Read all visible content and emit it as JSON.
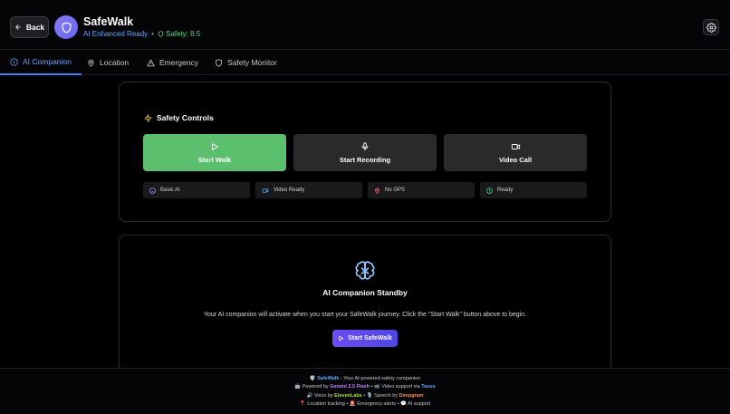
{
  "header": {
    "back_label": "Back",
    "title": "SafeWalk",
    "status_ai": "AI Enhanced Ready",
    "status_sep": "•",
    "safety_label": "Safety: 8.5"
  },
  "tabs": [
    {
      "label": "AI Companion",
      "icon": "info-icon",
      "active": true
    },
    {
      "label": "Location",
      "icon": "map-pin-icon",
      "active": false
    },
    {
      "label": "Emergency",
      "icon": "warning-icon",
      "active": false
    },
    {
      "label": "Safety Monitor",
      "icon": "shield-icon",
      "active": false
    }
  ],
  "controls": {
    "title": "Safety Controls",
    "buttons": [
      {
        "label": "Start Walk",
        "icon": "play-icon"
      },
      {
        "label": "Start Recording",
        "icon": "microphone-icon"
      },
      {
        "label": "Video Call",
        "icon": "video-icon"
      }
    ],
    "chips": [
      {
        "label": "Basic AI",
        "icon": "bot-icon"
      },
      {
        "label": "Video Ready",
        "icon": "video-icon"
      },
      {
        "label": "No GPS",
        "icon": "map-pin-icon"
      },
      {
        "label": "Ready",
        "icon": "clock-icon"
      }
    ]
  },
  "standby": {
    "title": "AI Companion Standby",
    "description": "Your AI companion will activate when you start your SafeWalk journey. Click the \"Start Walk\" button above to begin.",
    "button_label": "Start SafeWalk"
  },
  "footer": {
    "line1": {
      "icon": "🛡️",
      "brand": "SafeWalk",
      "text": " - Your AI-powered safety companion"
    },
    "line2": {
      "icon": "🤖",
      "pre": " Powered by ",
      "model": "Gemini 2.5 Flash",
      "mid": " • 📹 Video support via ",
      "video": "Tavus"
    },
    "line3": {
      "icon": "🔊",
      "pre": " Voice by ",
      "voice": "ElevenLabs",
      "mid": " • 🎙️ Speech by ",
      "speech": "Deepgram"
    },
    "line4": "📍 Location tracking • 🚨 Emergency alerts • 💬 AI support"
  },
  "colors": {
    "accent": "#3b82f6",
    "primary_button": "#5cbf6e",
    "safety_green": "#4ade80",
    "gradient_start": "#6d4cf5",
    "gradient_end": "#4f46e5"
  }
}
